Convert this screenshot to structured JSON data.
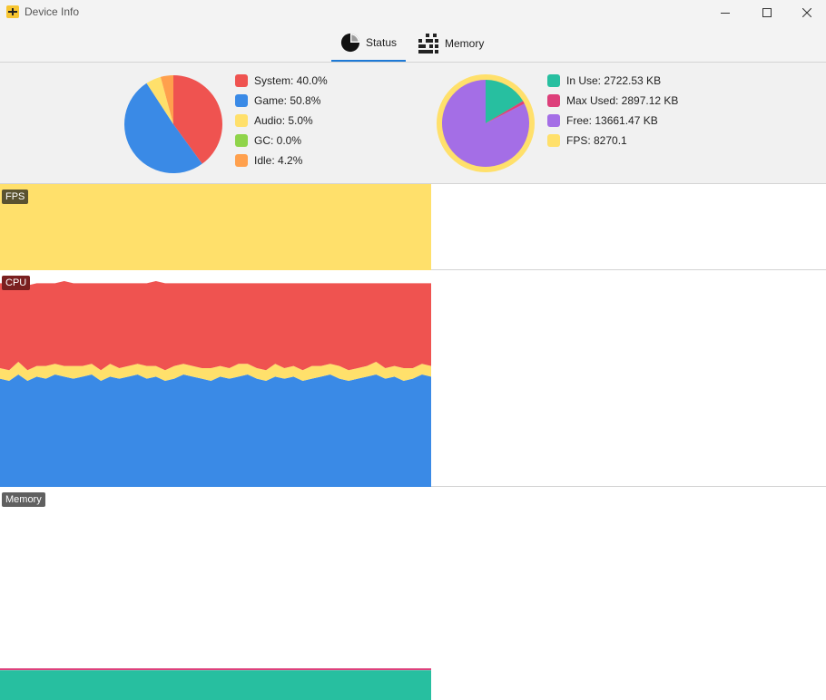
{
  "window": {
    "title": "Device Info"
  },
  "tabs": {
    "status": "Status",
    "memory": "Memory"
  },
  "cpu_summary": {
    "slices": [
      {
        "label": "System: 40.0%",
        "value": 40.0,
        "color": "#ef5350"
      },
      {
        "label": "Game: 50.8%",
        "value": 50.8,
        "color": "#3a8ae6"
      },
      {
        "label": "Audio: 5.0%",
        "value": 5.0,
        "color": "#ffe06b"
      },
      {
        "label": "GC: 0.0%",
        "value": 0.0,
        "color": "#8fd44a"
      },
      {
        "label": "Idle: 4.2%",
        "value": 4.2,
        "color": "#ffa04d"
      }
    ]
  },
  "memory_summary": {
    "items": [
      {
        "label": "In Use: 2722.53 KB",
        "value": 2722.53,
        "color": "#27bfa0"
      },
      {
        "label": "Max Used: 2897.12 KB",
        "value": 2897.12,
        "color": "#dd3f7a"
      },
      {
        "label": "Free: 13661.47 KB",
        "value": 13661.47,
        "color": "#a46ee6"
      },
      {
        "label": "FPS: 8270.1",
        "value": 8270.1,
        "color": "#ffe06b"
      }
    ]
  },
  "graphs": {
    "fps": {
      "label": "FPS",
      "fill": "#ffe06b",
      "level": 1.0,
      "label_bg": "#5a5230"
    },
    "cpu": {
      "label": "CPU",
      "label_bg": "#7a2020",
      "colors": {
        "game": "#3a8ae6",
        "audio": "#ffe06b",
        "system": "#ef5350"
      }
    },
    "memory": {
      "label": "Memory",
      "label_bg": "#606060",
      "in_use_color": "#27bfa0",
      "max_color": "#dd3f7a"
    }
  },
  "chart_data": [
    {
      "type": "pie",
      "categories": [
        "System",
        "Game",
        "Audio",
        "GC",
        "Idle"
      ],
      "values": [
        40.0,
        50.8,
        5.0,
        0.0,
        4.2
      ]
    },
    {
      "type": "pie",
      "categories": [
        "In Use",
        "Max Used",
        "Free"
      ],
      "values": [
        2722.53,
        2897.12,
        13661.47
      ]
    },
    {
      "type": "area",
      "series": [
        {
          "name": "Game",
          "values": [
            51,
            50,
            53,
            50,
            52,
            51,
            53,
            52,
            51,
            52,
            53,
            50,
            52,
            51,
            52,
            53,
            51,
            52,
            50,
            51,
            53,
            52,
            51,
            50,
            52,
            51,
            52,
            53,
            51,
            50,
            52,
            51,
            52,
            50,
            51,
            52,
            53,
            51,
            50,
            51,
            52,
            53,
            51,
            52,
            50,
            51,
            53,
            52
          ]
        },
        {
          "name": "Audio",
          "values": [
            5,
            5,
            6,
            5,
            5,
            6,
            5,
            5,
            6,
            5,
            5,
            5,
            6,
            5,
            5,
            5,
            6,
            5,
            5,
            6,
            5,
            5,
            5,
            6,
            5,
            5,
            6,
            5,
            5,
            5,
            6,
            5,
            5,
            5,
            6,
            5,
            5,
            6,
            5,
            5,
            5,
            6,
            5,
            5,
            6,
            5,
            5,
            5
          ]
        },
        {
          "name": "System",
          "values": [
            40,
            41,
            38,
            40,
            39,
            39,
            38,
            40,
            39,
            39,
            38,
            41,
            38,
            40,
            39,
            38,
            39,
            40,
            41,
            39,
            38,
            39,
            40,
            40,
            39,
            40,
            38,
            38,
            40,
            41,
            38,
            40,
            39,
            41,
            39,
            39,
            38,
            39,
            41,
            40,
            39,
            37,
            40,
            39,
            40,
            40,
            38,
            39
          ]
        }
      ]
    }
  ]
}
